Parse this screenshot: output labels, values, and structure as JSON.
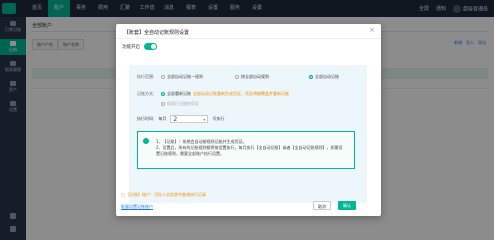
{
  "topbar": {
    "nav": [
      "首页",
      "账户",
      "事务",
      "费用",
      "汇聚",
      "工作流",
      "消息",
      "报表",
      "设置",
      "服务",
      "设置"
    ],
    "active_index": 1,
    "right": [
      "全屏",
      "通知",
      "超级管理员"
    ]
  },
  "sidebar": {
    "items": [
      "日常记账",
      "出纳",
      "报表管理",
      "资产",
      "设置"
    ],
    "active_index": 1
  },
  "page": {
    "title": "全部账户",
    "tabs": [
      "账户户名",
      "账户名称"
    ],
    "toolbar": [
      "新增",
      "导入",
      "导出"
    ]
  },
  "dialog": {
    "title": "【账套】全自动记账规则设置",
    "close": "×",
    "toggle_label": "功能开启",
    "row1_label": "执行范围:",
    "row1_options": [
      "全部自动记账一规则",
      "按全部自动规则",
      "全部自动记账"
    ],
    "row1_selected": 2,
    "row2_label": "记账方式:",
    "row2_option": "全部重新记账",
    "row2_desc": "全部自动记账重新生成凭证，凭证将被覆盖并重新记账",
    "row3_option": "保留已记账的凭证",
    "row4_label": "执行时间:",
    "row4_prefix": "每月",
    "row4_value": "2",
    "row4_suffix": "号执行",
    "note": [
      "1、【记账】：系统会自动按规则记账并生成凭证。",
      "2、设置后，所有的记账规则都将按设置执行，每月执行【全自动记账】或者【全自动记账规则】，如需设置记账规则，需要全部账户执行设置。"
    ],
    "tip": "□ 【记账】账户：可在人员信息中查询执行记录",
    "link": "批量设置记账账户",
    "cancel": "取消",
    "ok": "确认"
  }
}
